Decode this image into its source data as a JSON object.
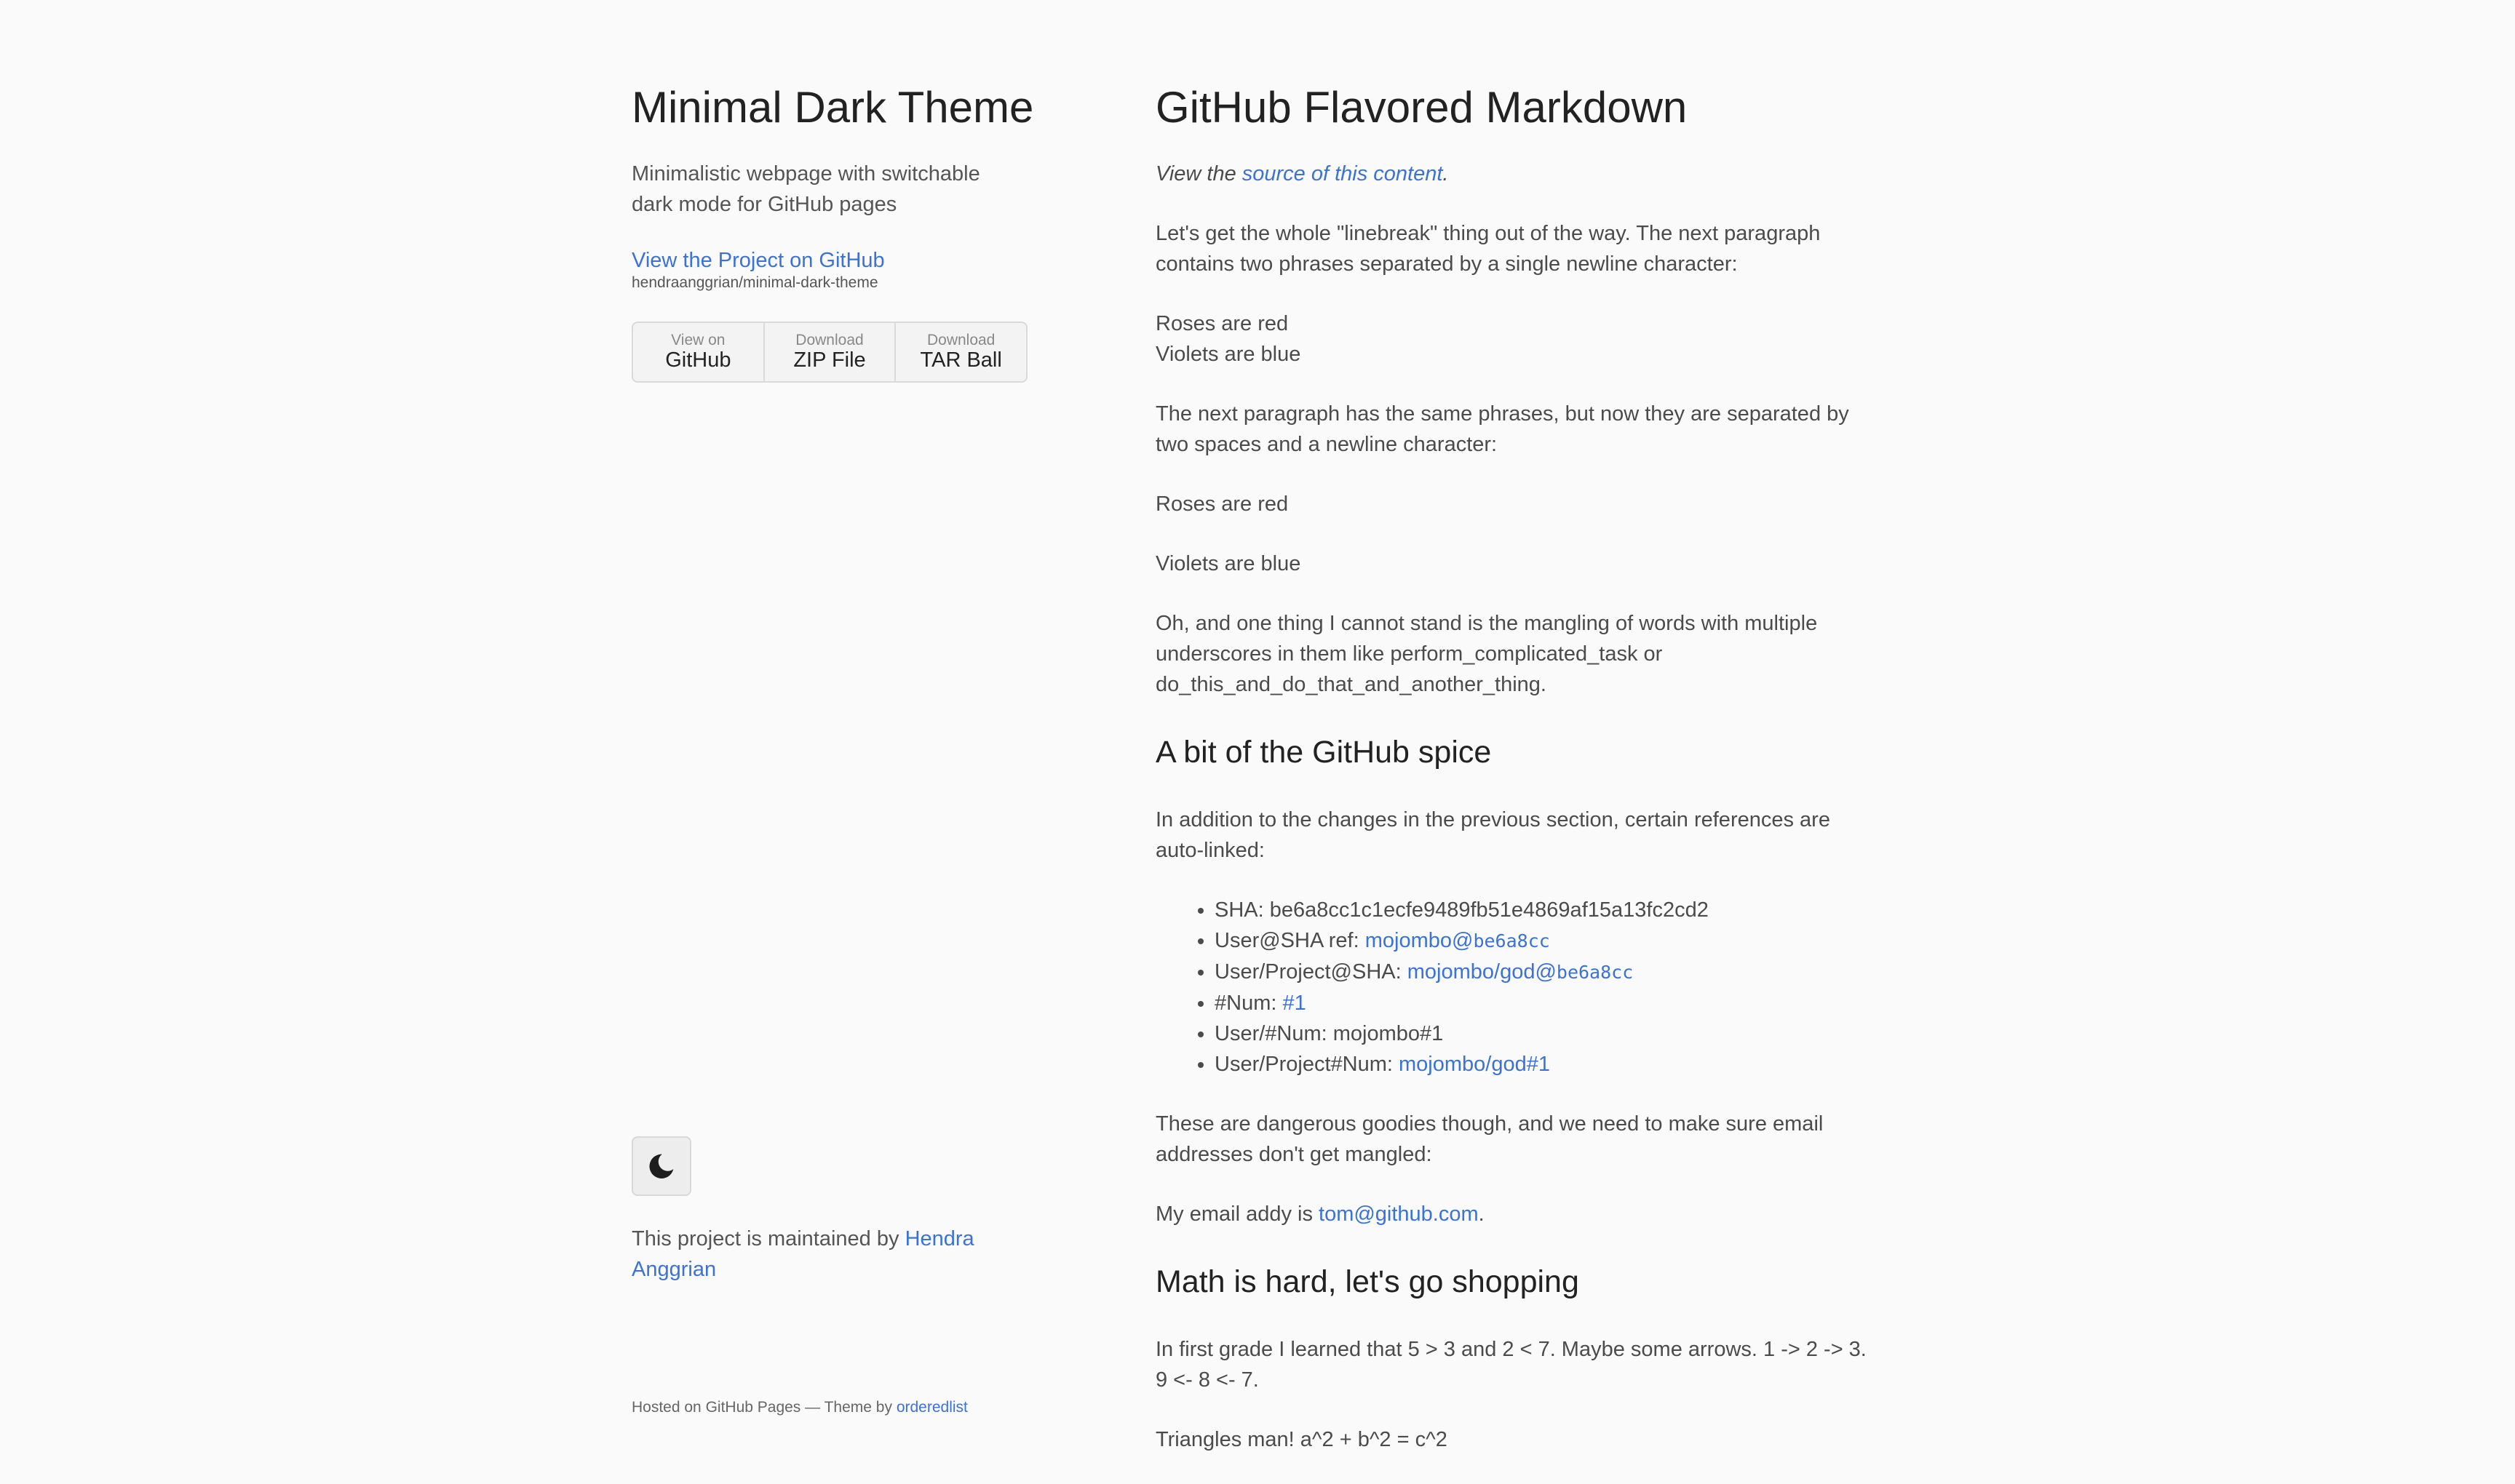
{
  "sidebar": {
    "title": "Minimal Dark Theme",
    "description": "Minimalistic webpage with switchable dark mode for GitHub pages",
    "project_link": "View the Project on GitHub",
    "repo_path": "hendraanggrian/minimal-dark-theme",
    "downloads": [
      {
        "small": "View on",
        "big": "GitHub"
      },
      {
        "small": "Download",
        "big": "ZIP File"
      },
      {
        "small": "Download",
        "big": "TAR Ball"
      }
    ],
    "theme_toggle_icon": "moon-icon",
    "maintained_prefix": "This project is maintained by ",
    "maintainer": "Hendra Anggrian",
    "hosted_prefix": "Hosted on GitHub Pages — Theme by ",
    "hosted_link": "orderedlist"
  },
  "main": {
    "title": "GitHub Flavored Markdown",
    "view_prefix": "View the ",
    "view_link": "source of this content",
    "view_suffix": ".",
    "p_linebreak": "Let's get the whole \"linebreak\" thing out of the way. The next paragraph contains two phrases separated by a single newline character:",
    "roses": "Roses are red",
    "violets": "Violets are blue",
    "p_next": "The next paragraph has the same phrases, but now they are separated by two spaces and a newline character:",
    "p_mangling": "Oh, and one thing I cannot stand is the mangling of words with multiple underscores in them like perform_complicated_task or do_this_and_do_that_and_another_thing.",
    "h_spice": "A bit of the GitHub spice",
    "p_spice": "In addition to the changes in the previous section, certain references are auto-linked:",
    "refs": {
      "sha_label": "SHA: ",
      "sha_value": "be6a8cc1c1ecfe9489fb51e4869af15a13fc2cd2",
      "usersha_label": "User@SHA ref: ",
      "usersha_link": "mojombo@",
      "usersha_code": "be6a8cc",
      "projsha_label": "User/Project@SHA: ",
      "projsha_link": "mojombo/god@",
      "projsha_code": "be6a8cc",
      "num_label": "#Num: ",
      "num_link": "#1",
      "usernum_label": "User/#Num: ",
      "usernum_value": "mojombo#1",
      "projnum_label": "User/Project#Num: ",
      "projnum_link": "mojombo/god#1"
    },
    "p_dangerous": "These are dangerous goodies though, and we need to make sure email addresses don't get mangled:",
    "email_prefix": "My email addy is ",
    "email": "tom@github.com",
    "email_suffix": ".",
    "h_math": "Math is hard, let's go shopping",
    "p_first_grade": "In first grade I learned that 5 > 3 and 2 < 7. Maybe some arrows. 1 -> 2 -> 3. 9 <- 8 <- 7.",
    "p_triangles": "Triangles man! a^2 + b^2 = c^2"
  },
  "colors": {
    "background": "#fafafa",
    "text": "#4b4b4b",
    "heading": "#222222",
    "link": "#3a72d8"
  }
}
